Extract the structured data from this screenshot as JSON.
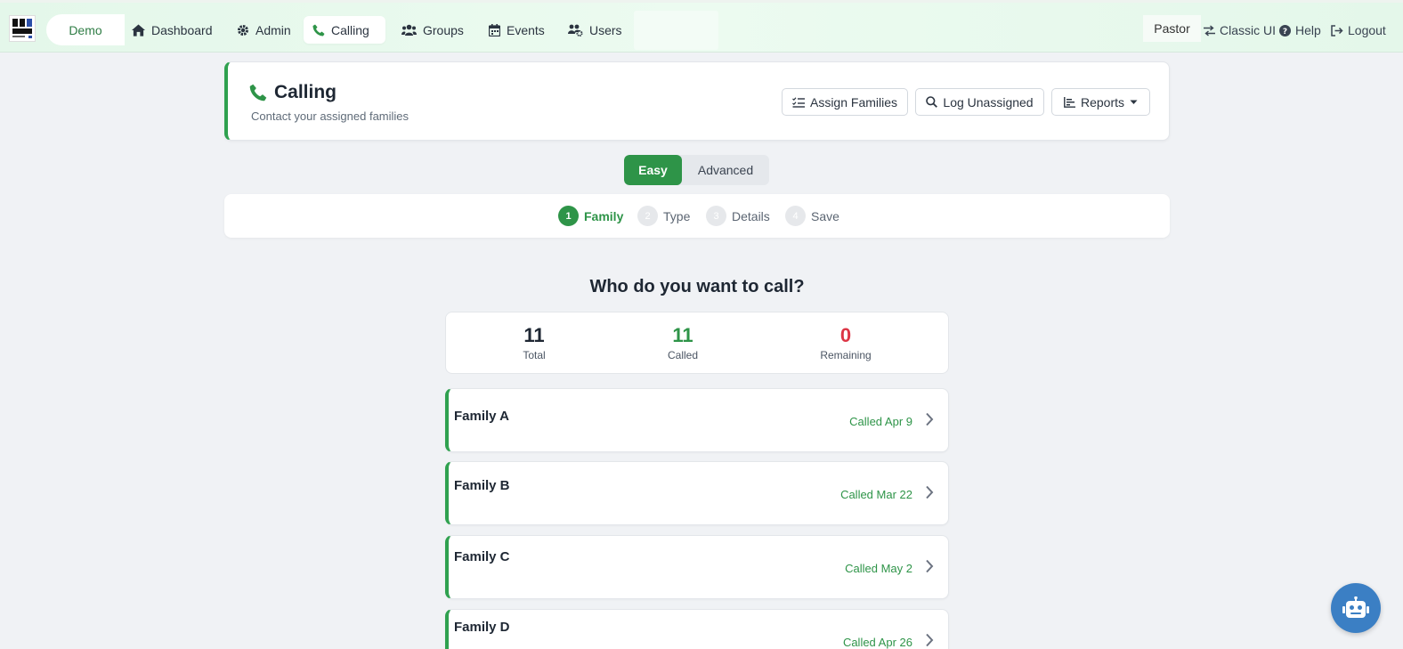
{
  "nav": {
    "org": "Demo",
    "items": [
      {
        "label": "Dashboard",
        "icon": "home-icon"
      },
      {
        "label": "Admin",
        "icon": "gear-icon"
      },
      {
        "label": "Calling",
        "icon": "phone-icon",
        "active": true
      },
      {
        "label": "Groups",
        "icon": "users-group-icon"
      },
      {
        "label": "Events",
        "icon": "calendar-icon"
      },
      {
        "label": "Users",
        "icon": "users-gear-icon"
      }
    ],
    "role": "Pastor",
    "classic_ui": "Classic UI",
    "help": "Help",
    "logout": "Logout"
  },
  "header": {
    "title": "Calling",
    "subtitle": "Contact your assigned families",
    "assign_label": "Assign Families",
    "log_label": "Log Unassigned",
    "reports_label": "Reports"
  },
  "mode": {
    "easy": "Easy",
    "advanced": "Advanced",
    "selected": "Easy"
  },
  "steps": [
    {
      "num": "1",
      "label": "Family",
      "active": true
    },
    {
      "num": "2",
      "label": "Type"
    },
    {
      "num": "3",
      "label": "Details"
    },
    {
      "num": "4",
      "label": "Save"
    }
  ],
  "question": "Who do you want to call?",
  "stats": {
    "total": {
      "value": "11",
      "label": "Total"
    },
    "called": {
      "value": "11",
      "label": "Called"
    },
    "remaining": {
      "value": "0",
      "label": "Remaining"
    }
  },
  "families": [
    {
      "name": "Family A",
      "status": "Called Apr 9"
    },
    {
      "name": "Family B",
      "status": "Called Mar 22"
    },
    {
      "name": "Family C",
      "status": "Called May 2"
    },
    {
      "name": "Family D",
      "status": "Called Apr 26"
    }
  ],
  "colors": {
    "accent": "#2e9448",
    "danger": "#dc3545",
    "bot": "#3b7fc4"
  }
}
